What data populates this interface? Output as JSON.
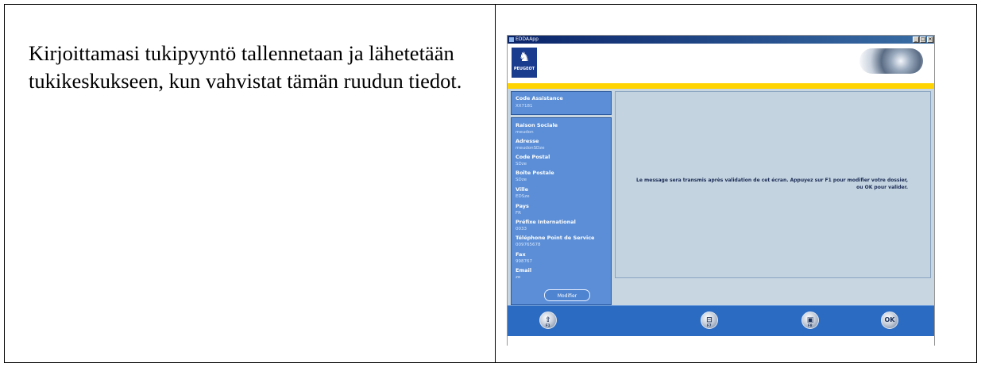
{
  "instruction": "Kirjoittamasi tukipyyntö tallennetaan ja lähetetään tukikeskukseen, kun vahvistat tämän ruudun tiedot.",
  "app": {
    "window_title": "EDDAApp",
    "brand": "PEUGEOT",
    "code_assistance": {
      "label": "Code Assistance",
      "value": "XX7181"
    },
    "fields": [
      {
        "label": "Raison Sociale",
        "value": "meudon"
      },
      {
        "label": "Adresse",
        "value": "meudonSDze"
      },
      {
        "label": "Code Postal",
        "value": "SDze"
      },
      {
        "label": "Boîte Postale",
        "value": "SDze"
      },
      {
        "label": "Ville",
        "value": "EDSze"
      },
      {
        "label": "Pays",
        "value": "FR"
      },
      {
        "label": "Préfixe International",
        "value": "0033"
      },
      {
        "label": "Téléphone Point de Service",
        "value": "009765678"
      },
      {
        "label": "Fax",
        "value": "998767"
      },
      {
        "label": "Email",
        "value": "ze"
      }
    ],
    "modify_label": "Modifier",
    "message": "Le message sera transmis après validation de cet écran. Appuyez sur F1 pour modifier votre dossier, ou OK pour valider.",
    "function_keys": [
      {
        "glyph": "⇧",
        "sub": "F1"
      },
      {
        "glyph": "⊟",
        "sub": "F7"
      },
      {
        "glyph": "▣",
        "sub": "F8"
      },
      {
        "glyph": "OK",
        "sub": ""
      }
    ],
    "colors": {
      "panel_blue": "#5b8ed6",
      "accent_yellow": "#ffd400",
      "footer_blue": "#2b6bc2"
    }
  }
}
